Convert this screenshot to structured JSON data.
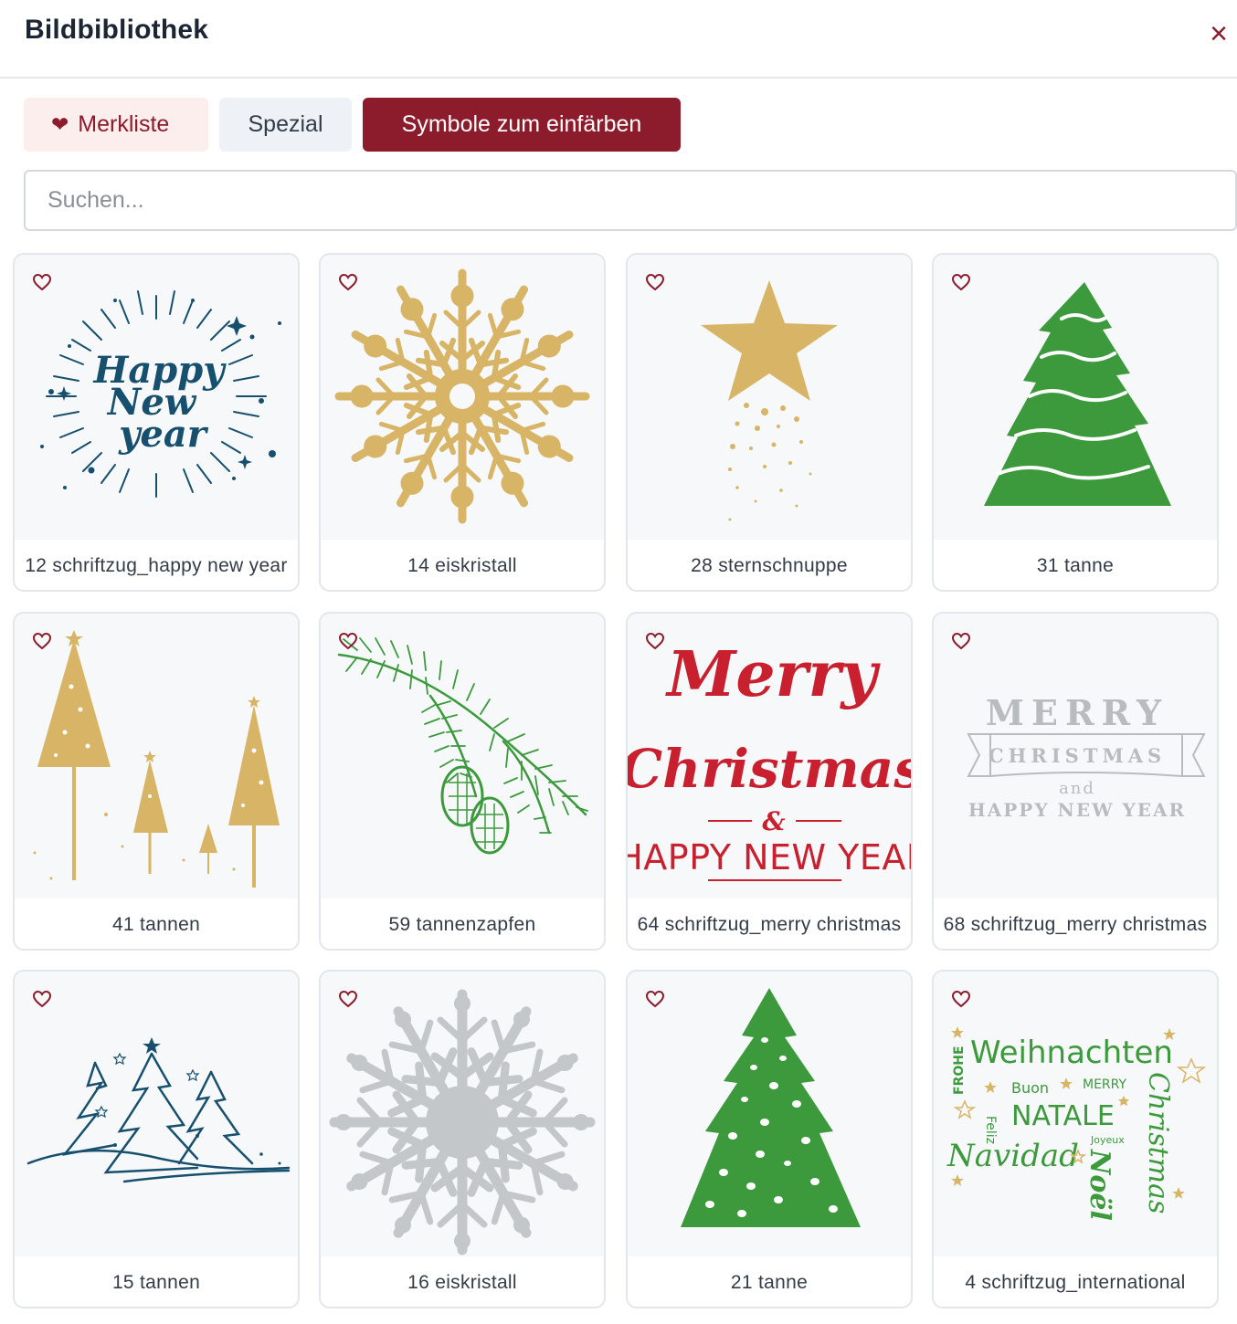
{
  "header": {
    "title": "Bildbibliothek",
    "close_icon": "close-icon",
    "close_glyph": "×"
  },
  "tabs": [
    {
      "label": "Merkliste",
      "icon": "heart-icon",
      "heart_glyph": "❤"
    },
    {
      "label": "Spezial"
    },
    {
      "label": "Symbole zum einfärben",
      "active": true
    }
  ],
  "search": {
    "placeholder": "Suchen...",
    "value": ""
  },
  "colors": {
    "accent": "#8c1c2c",
    "gold": "#d8b466",
    "green": "#3c9a3c",
    "navy": "#17506e",
    "red": "#c8202e",
    "silver": "#c4c7ca"
  },
  "grid": {
    "items": [
      {
        "label": "12 schriftzug_happy new year",
        "image": "happy-new-year-lettering",
        "text_lines": [
          "Happy",
          "New",
          "year"
        ]
      },
      {
        "label": "14 eiskristall",
        "image": "gold-snowflake"
      },
      {
        "label": "28 sternschnuppe",
        "image": "shooting-star"
      },
      {
        "label": "31 tanne",
        "image": "green-fir-tree-waves"
      },
      {
        "label": "41 tannen",
        "image": "gold-trees"
      },
      {
        "label": "59 tannenzapfen",
        "image": "pine-branch-cones"
      },
      {
        "label": "64 schriftzug_merry christmas",
        "image": "merry-christmas-red",
        "text_lines": [
          "Merry",
          "Christmas",
          "&",
          "HAPPY NEW YEAR"
        ]
      },
      {
        "label": "68 schriftzug_merry christmas",
        "image": "merry-christmas-grey",
        "text_lines": [
          "MERRY",
          "CHRISTMAS",
          "and",
          "HAPPY NEW YEAR"
        ]
      },
      {
        "label": "15 tannen",
        "image": "navy-sketch-trees"
      },
      {
        "label": "16 eiskristall",
        "image": "silver-snowflake"
      },
      {
        "label": "21 tanne",
        "image": "green-fir-tree-dots"
      },
      {
        "label": "4 schriftzug_international",
        "image": "international-words",
        "text_lines": [
          "Weihnachten",
          "FROHE",
          "Buon",
          "MERRY",
          "NATALE",
          "Feliz",
          "Navidad",
          "Joyeux",
          "Noël",
          "Christmas"
        ]
      }
    ]
  }
}
